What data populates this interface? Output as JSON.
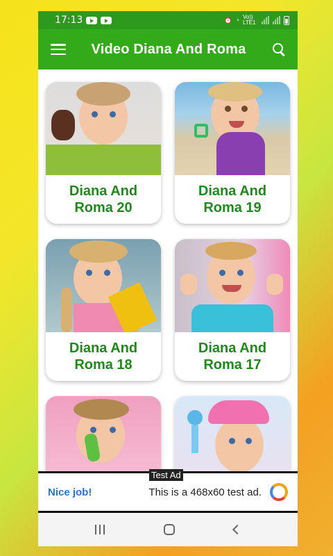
{
  "status_bar": {
    "time": "17:13",
    "network": "Vo)) LTE1",
    "icons": [
      "youtube-icon",
      "youtube-icon",
      "alarm-icon",
      "wifi-icon",
      "signal-icon",
      "signal-icon",
      "battery-icon"
    ]
  },
  "app_bar": {
    "title": "Video Diana And Roma",
    "menu_icon": "hamburger-menu-icon",
    "search_icon": "search-icon"
  },
  "colors": {
    "status_bar": "#2d9a1e",
    "app_bar": "#33aa1a",
    "card_title": "#1e8a1a",
    "ad_accent": "#2a73d0"
  },
  "videos": [
    {
      "title": "Diana And Roma 20"
    },
    {
      "title": "Diana And Roma 19"
    },
    {
      "title": "Diana And Roma 18"
    },
    {
      "title": "Diana And Roma 17"
    },
    {
      "title": ""
    },
    {
      "title": ""
    }
  ],
  "ad": {
    "tag": "Test Ad",
    "nice": "Nice job!",
    "text": "This is a 468x60 test ad.",
    "icon": "adchoices-icon"
  },
  "nav_bar": {
    "icons": [
      "recent-apps-icon",
      "home-icon",
      "back-icon"
    ]
  }
}
